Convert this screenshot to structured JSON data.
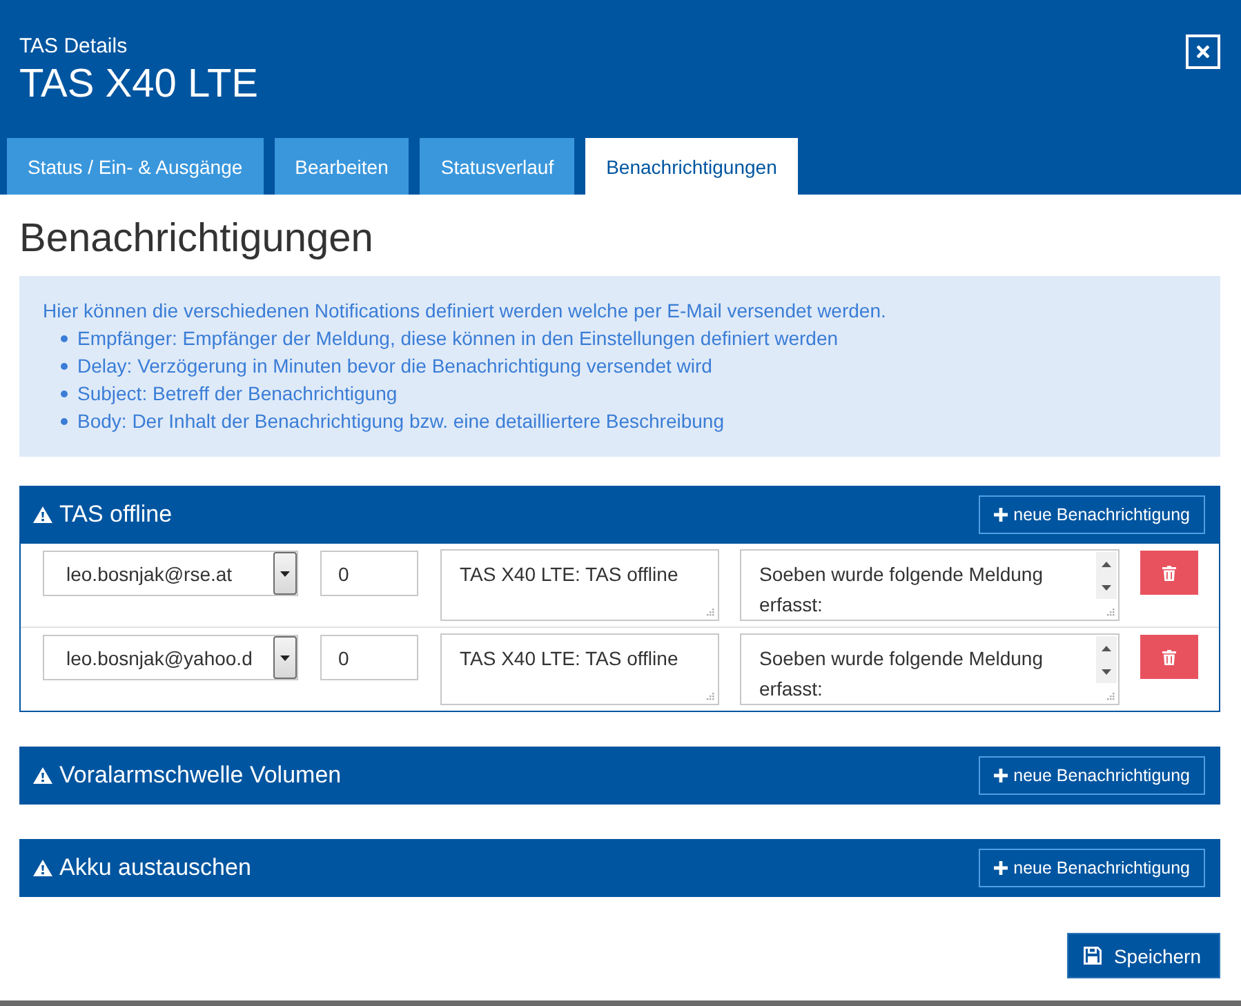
{
  "window": {
    "subtitle": "TAS Details",
    "title": "TAS X40 LTE"
  },
  "tabs": [
    {
      "label": "Status / Ein- & Ausgänge",
      "selected": false
    },
    {
      "label": "Bearbeiten",
      "selected": false
    },
    {
      "label": "Statusverlauf",
      "selected": false
    },
    {
      "label": "Benachrichtigungen",
      "selected": true
    }
  ],
  "heading": "Benachrichtigungen",
  "info": {
    "intro": "Hier können die verschiedenen Notifications definiert werden welche per E-Mail versendet werden.",
    "items": [
      "Empfänger: Empfänger der Meldung, diese können in den Einstellungen definiert werden",
      "Delay: Verzögerung in Minuten bevor die Benachrichtigung versendet wird",
      "Subject: Betreff der Benachrichtigung",
      "Body: Der Inhalt der Benachrichtigung bzw. eine detailliertere Beschreibung"
    ]
  },
  "groups": [
    {
      "title": "TAS offline",
      "add_button": "neue Benachrichtigung",
      "notifications": [
        {
          "recipient": "leo.bosnjak@rse.at",
          "delay": "0",
          "subject": "TAS X40 LTE: TAS offline",
          "body": "Soeben wurde folgende Meldung erfasst:"
        },
        {
          "recipient": "leo.bosnjak@yahoo.d",
          "delay": "0",
          "subject": "TAS X40 LTE: TAS offline",
          "body": "Soeben wurde folgende Meldung erfasst:"
        }
      ]
    },
    {
      "title": "Voralarmschwelle Volumen",
      "add_button": "neue Benachrichtigung"
    },
    {
      "title": "Akku austauschen",
      "add_button": "neue Benachrichtigung"
    }
  ],
  "save_button": "Speichern"
}
